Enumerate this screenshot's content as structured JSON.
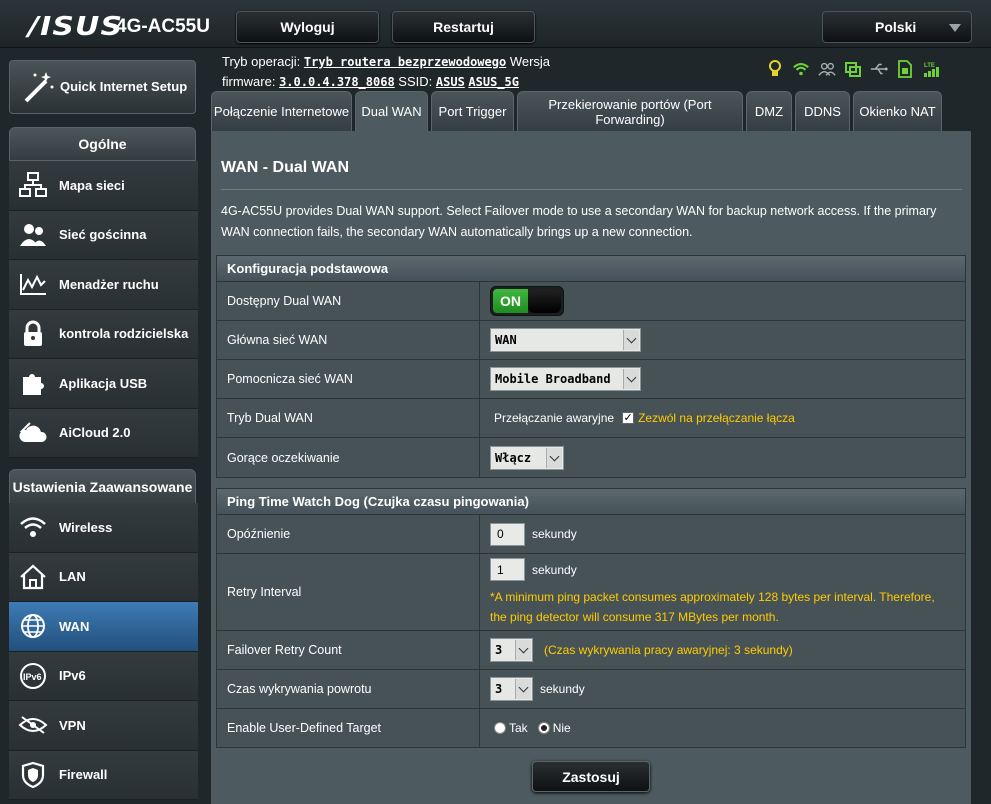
{
  "header": {
    "logo": "/ISUS",
    "model": "4G-AC55U",
    "logout_label": "Wyloguj",
    "restart_label": "Restartuj",
    "language": "Polski"
  },
  "opinfo": {
    "mode_label": "Tryb operacji:",
    "mode_value": "Tryb routera bezprzewodowego",
    "version_label": "Wersja",
    "firmware_label": "firmware:",
    "firmware_value": "3.0.0.4.378_8068",
    "ssid_label": "SSID:",
    "ssid_1": "ASUS",
    "ssid_2": "ASUS_5G"
  },
  "status_icons": [
    "lightbulb-icon",
    "wifi-signal-icon",
    "clients-icon",
    "external-storage-icon",
    "usb-icon",
    "sim-icon",
    "lte-signal-icon"
  ],
  "sidebar": {
    "qis_label": "Quick Internet Setup",
    "general_header": "Ogólne",
    "general_items": [
      {
        "label": "Mapa sieci",
        "icon": "network-map-icon"
      },
      {
        "label": "Sieć gościnna",
        "icon": "guest-network-icon"
      },
      {
        "label": "Menadżer ruchu",
        "icon": "traffic-manager-icon"
      },
      {
        "label": "kontrola rodzicielska",
        "icon": "parental-lock-icon"
      },
      {
        "label": "Aplikacja USB",
        "icon": "usb-app-icon"
      },
      {
        "label": "AiCloud 2.0",
        "icon": "aicloud-icon"
      }
    ],
    "advanced_header": "Ustawienia Zaawansowane",
    "advanced_items": [
      {
        "label": "Wireless",
        "icon": "wireless-icon"
      },
      {
        "label": "LAN",
        "icon": "lan-home-icon"
      },
      {
        "label": "WAN",
        "icon": "wan-globe-icon"
      },
      {
        "label": "IPv6",
        "icon": "ipv6-icon"
      },
      {
        "label": "VPN",
        "icon": "vpn-icon"
      },
      {
        "label": "Firewall",
        "icon": "firewall-icon"
      }
    ]
  },
  "tabs": [
    {
      "label": "Połączenie Internetowe"
    },
    {
      "label": "Dual WAN"
    },
    {
      "label": "Port Trigger"
    },
    {
      "label": "Przekierowanie portów (Port Forwarding)"
    },
    {
      "label": "DMZ"
    },
    {
      "label": "DDNS"
    },
    {
      "label": "Okienko NAT"
    }
  ],
  "page": {
    "title": "WAN - Dual WAN",
    "description": "4G-AC55U provides Dual WAN support. Select Failover mode to use a secondary WAN for backup network access. If the primary WAN connection fails, the secondary WAN automatically brings up a new connection."
  },
  "basic": {
    "header": "Konfiguracja podstawowa",
    "enable_label": "Dostępny Dual WAN",
    "enable_value": "ON",
    "primary_label": "Główna sieć WAN",
    "primary_value": "WAN",
    "secondary_label": "Pomocnicza sieć WAN",
    "secondary_value": "Mobile Broadband",
    "mode_label": "Tryb Dual WAN",
    "mode_value": "Przełączanie awaryjne",
    "allow_failback": "Zezwól na przełączanie łącza",
    "standby_label": "Gorące oczekiwanie",
    "standby_value": "Włącz"
  },
  "ping": {
    "header": "Ping Time Watch Dog (Czujka czasu pingowania)",
    "delay_label": "Opóźnienie",
    "delay_value": "0",
    "delay_unit": "sekundy",
    "retry_label": "Retry Interval",
    "retry_value": "1",
    "retry_unit": "sekundy",
    "retry_note_1": "*A minimum ping packet consumes approximately 128 bytes per interval. Therefore,",
    "retry_note_2": "the ping detector will consume 317 MBytes per month.",
    "failover_label": "Failover Retry Count",
    "failover_value": "3",
    "failover_note": "(Czas wykrywania pracy awaryjnej: 3  sekundy)",
    "recovery_label": "Czas wykrywania powrotu",
    "recovery_value": "3",
    "recovery_unit": "sekundy",
    "target_label": "Enable User-Defined Target",
    "target_yes": "Tak",
    "target_no": "Nie",
    "target_selected": "Nie"
  },
  "apply_label": "Zastosuj"
}
